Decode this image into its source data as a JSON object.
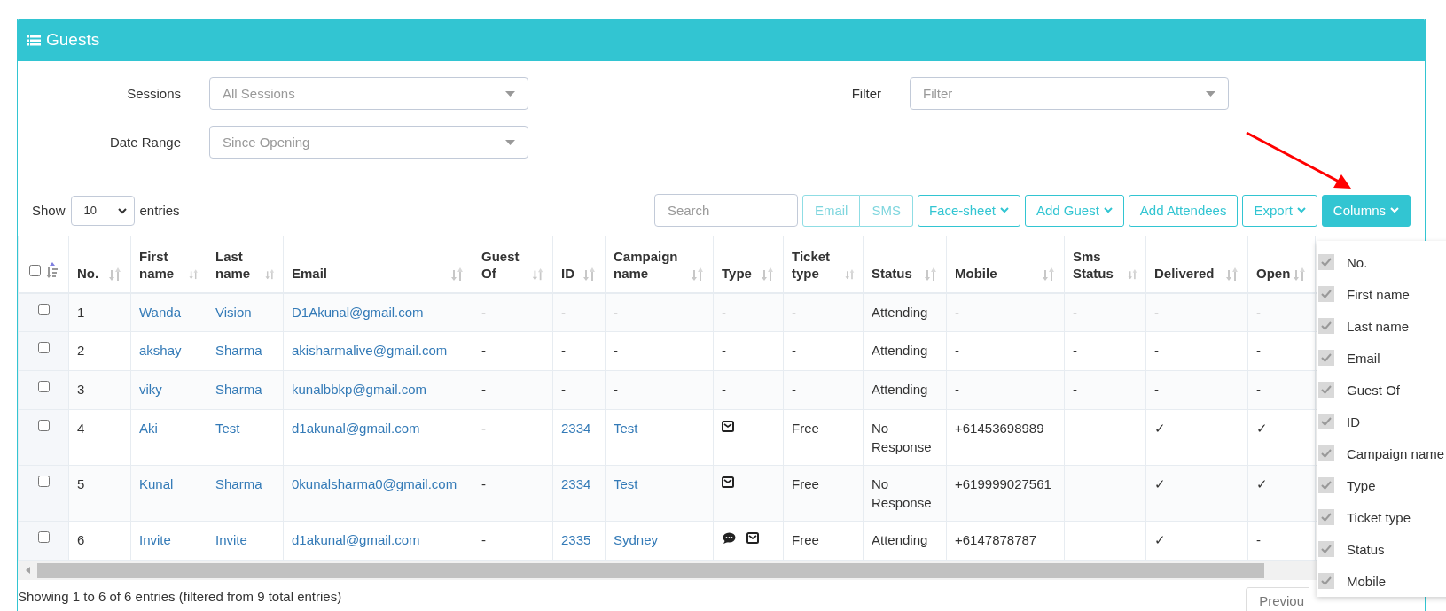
{
  "panel": {
    "title": "Guests"
  },
  "filters": [
    {
      "label": "Sessions",
      "placeholder": "All Sessions"
    },
    {
      "label": "Filter",
      "placeholder": "Filter"
    },
    {
      "label": "Date Range",
      "placeholder": "Since Opening"
    }
  ],
  "length": {
    "before": "Show",
    "value": "10",
    "after": "entries"
  },
  "toolbar": {
    "search_placeholder": "Search",
    "button_group": [
      {
        "label": "Email",
        "disabled": true
      },
      {
        "label": "SMS",
        "disabled": true
      }
    ],
    "buttons": [
      {
        "label": "Face-sheet",
        "caret": true,
        "expanded": false
      },
      {
        "label": "Add Guest",
        "caret": true,
        "expanded": false
      },
      {
        "label": "Add Attendees",
        "caret": false,
        "expanded": false
      },
      {
        "label": "Export",
        "caret": true,
        "expanded": false
      },
      {
        "label": "Columns",
        "caret": true,
        "expanded": true
      }
    ]
  },
  "table": {
    "select_all": {
      "checked": false
    },
    "columns": [
      "No.",
      "First name",
      "Last name",
      "Email",
      "Guest Of",
      "ID",
      "Campaign name",
      "Type",
      "Ticket type",
      "Status",
      "Mobile",
      "Sms Status",
      "Delivered",
      "Open"
    ],
    "rows": [
      {
        "selected": false,
        "no": "1",
        "first_name": "Wanda",
        "last_name": "Vision",
        "email": "D1Akunal@gmail.com",
        "guest_of": "-",
        "id": "-",
        "campaign_name": "-",
        "type": "-",
        "ticket_type": "-",
        "status": "Attending",
        "mobile": "-",
        "sms_status": "-",
        "delivered": "-",
        "open": "-"
      },
      {
        "selected": false,
        "no": "2",
        "first_name": "akshay",
        "last_name": "Sharma",
        "email": "akisharmalive@gmail.com",
        "guest_of": "-",
        "id": "-",
        "campaign_name": "-",
        "type": "-",
        "ticket_type": "-",
        "status": "Attending",
        "mobile": "-",
        "sms_status": "-",
        "delivered": "-",
        "open": "-"
      },
      {
        "selected": false,
        "no": "3",
        "first_name": "viky",
        "last_name": "Sharma",
        "email": "kunalbbkp@gmail.com",
        "guest_of": "-",
        "id": "-",
        "campaign_name": "-",
        "type": "-",
        "ticket_type": "-",
        "status": "Attending",
        "mobile": "-",
        "sms_status": "-",
        "delivered": "-",
        "open": "-"
      },
      {
        "selected": false,
        "no": "4",
        "first_name": "Aki",
        "last_name": "Test",
        "email": "d1akunal@gmail.com",
        "guest_of": "-",
        "id": "2334",
        "campaign_name": "Test",
        "type_icons": [
          {
            "kind": "email"
          }
        ],
        "ticket_type": "Free",
        "status": "No Response",
        "mobile": "+61453698989",
        "delivered": "✓",
        "open": "✓"
      },
      {
        "selected": false,
        "no": "5",
        "first_name": "Kunal",
        "last_name": "Sharma",
        "email": "0kunalsharma0@gmail.com",
        "guest_of": "-",
        "id": "2334",
        "campaign_name": "Test",
        "type_icons": [
          {
            "kind": "email"
          }
        ],
        "ticket_type": "Free",
        "status": "No Response",
        "mobile": "+619999027561",
        "delivered": "✓",
        "open": "✓"
      },
      {
        "selected": false,
        "no": "6",
        "first_name": "Invite",
        "last_name": "Invite",
        "email": "d1akunal@gmail.com",
        "guest_of": "-",
        "id": "2335",
        "campaign_name": "Sydney",
        "type_icons": [
          {
            "kind": "sms"
          },
          {
            "kind": "email"
          }
        ],
        "ticket_type": "Free",
        "status": "Attending",
        "mobile": "+6147878787",
        "delivered": "✓",
        "open": "-"
      }
    ]
  },
  "info": "Showing 1 to 6 of 6 entries (filtered from 9 total entries)",
  "pagination": {
    "previous": "Previou"
  },
  "columns_menu": [
    {
      "label": "No.",
      "checked": true
    },
    {
      "label": "First name",
      "checked": true
    },
    {
      "label": "Last name",
      "checked": true
    },
    {
      "label": "Email",
      "checked": true
    },
    {
      "label": "Guest Of",
      "checked": true
    },
    {
      "label": "ID",
      "checked": true
    },
    {
      "label": "Campaign name",
      "checked": true
    },
    {
      "label": "Type",
      "checked": true
    },
    {
      "label": "Ticket type",
      "checked": true
    },
    {
      "label": "Status",
      "checked": true
    },
    {
      "label": "Mobile",
      "checked": true
    }
  ]
}
